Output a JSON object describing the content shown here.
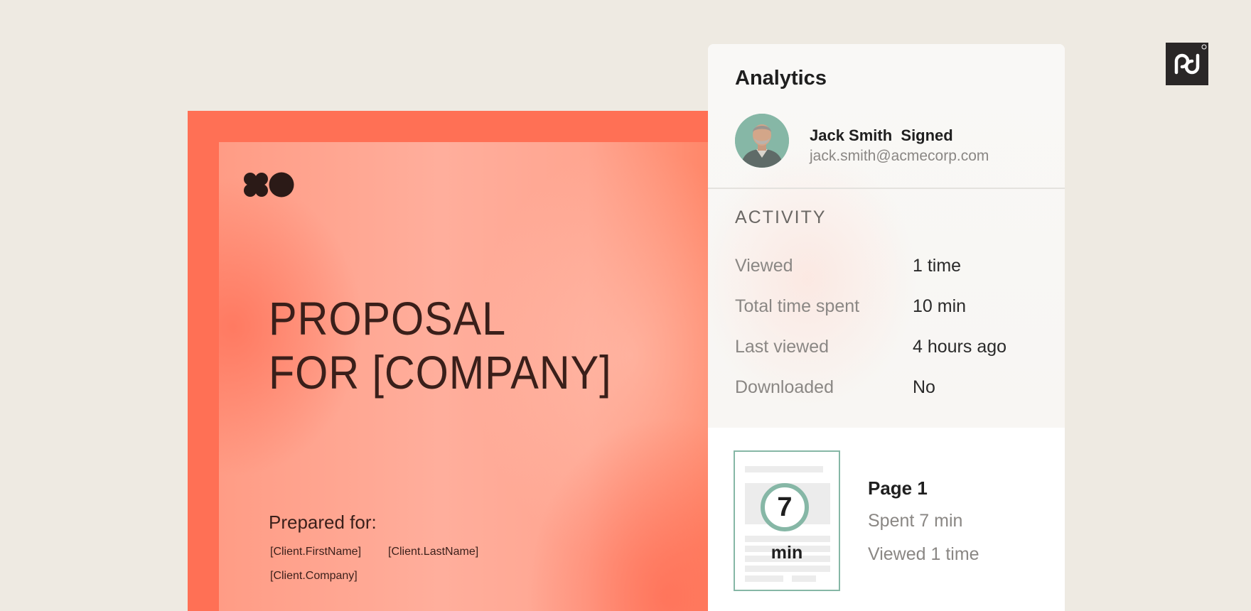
{
  "proposal": {
    "title_line1": "PROPOSAL",
    "title_line2": "FOR [COMPANY]",
    "prepared_for_label": "Prepared for:",
    "client_first_name": "[Client.FirstName]",
    "client_last_name": "[Client.LastName]",
    "client_company": "[Client.Company]"
  },
  "analytics": {
    "title": "Analytics",
    "signer": {
      "name_status": "Jack Smith  Signed",
      "email": "jack.smith@acmecorp.com"
    },
    "activity": {
      "heading": "ACTIVITY",
      "rows": [
        {
          "label": "Viewed",
          "value": "1 time"
        },
        {
          "label": "Total time spent",
          "value": "10 min"
        },
        {
          "label": "Last viewed",
          "value": "4 hours ago"
        },
        {
          "label": "Downloaded",
          "value": "No"
        }
      ]
    },
    "page_stats": {
      "timer_value": "7",
      "timer_unit": "min",
      "page_name": "Page 1",
      "spent": "Spent 7 min",
      "viewed": "Viewed 1 time"
    }
  },
  "icons": {
    "brand_logo": "pandadoc-logo-icon",
    "proposal_logo": "clover-circle-logo-icon"
  },
  "colors": {
    "background": "#eeeae2",
    "proposal_accent": "#ff7055",
    "timer_ring": "#86b7a6",
    "brand_tile": "#2a2727"
  }
}
